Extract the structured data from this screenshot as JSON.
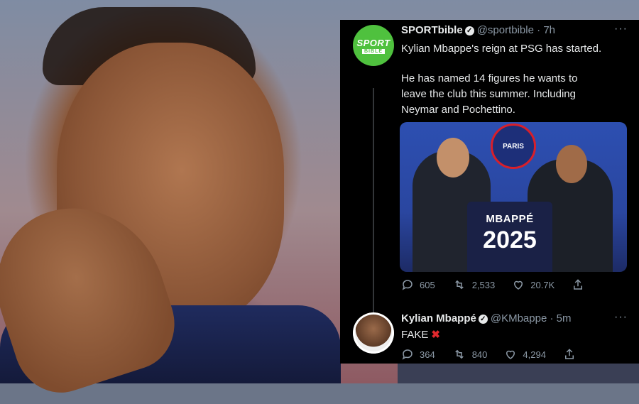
{
  "tweets": [
    {
      "author": "SPORTbible",
      "handle": "@sportbible",
      "time": "7h",
      "avatar_text_top": "SPORT",
      "avatar_text_bottom": "BIBLE",
      "line1": "Kylian Mbappe's reign at PSG has started.",
      "line2": "He has named 14 figures he wants to",
      "line3": "leave the club this summer. Including",
      "line4": "Neymar and Pochettino.",
      "image": {
        "logo_text": "PARIS",
        "jersey_name": "MBAPPÉ",
        "jersey_number": "2025"
      },
      "replies": "605",
      "retweets": "2,533",
      "likes": "20.7K"
    },
    {
      "author": "Kylian Mbappé",
      "handle": "@KMbappe",
      "time": "5m",
      "text": "FAKE",
      "emoji": "✖",
      "replies": "364",
      "retweets": "840",
      "likes": "4,294"
    }
  ],
  "colors": {
    "card_bg": "#000000",
    "text": "#e7e9ea",
    "muted": "#8b98a5",
    "sportbible_green": "#4fc13e",
    "fake_red": "#e0282d"
  },
  "icons": [
    "verified-badge-icon",
    "more-icon",
    "reply-icon",
    "retweet-icon",
    "like-icon",
    "share-icon"
  ]
}
